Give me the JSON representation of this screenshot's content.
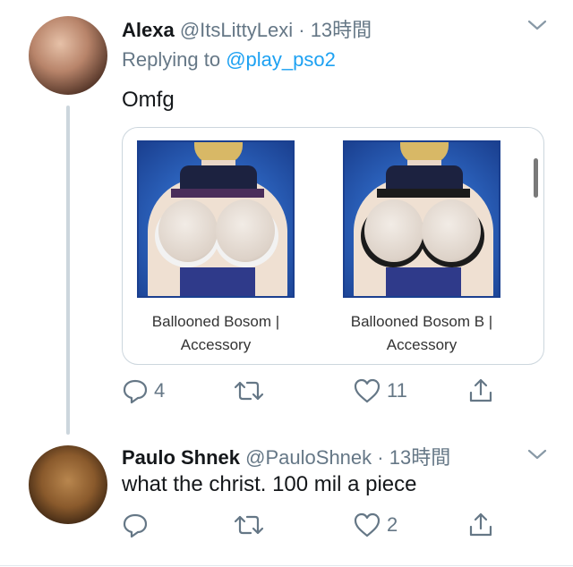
{
  "tweet1": {
    "name": "Alexa",
    "handle": "@ItsLittyLexi",
    "dot": "·",
    "time": "13時間",
    "replying_prefix": "Replying to ",
    "replying_mention": "@play_pso2",
    "text": "Omfg",
    "card": {
      "items": [
        {
          "caption_line1": "Ballooned Bosom |",
          "caption_line2": "Accessory",
          "variant": "white"
        },
        {
          "caption_line1": "Ballooned Bosom B |",
          "caption_line2": "Accessory",
          "variant": "black"
        }
      ]
    },
    "actions": {
      "replies": "4",
      "retweets": "",
      "likes": "11"
    }
  },
  "tweet2": {
    "name": "Paulo Shnek",
    "handle": "@PauloShnek",
    "dot": "·",
    "time": "13時間",
    "text": "what the christ. 100 mil a piece",
    "actions": {
      "replies": "",
      "retweets": "",
      "likes": "2"
    }
  },
  "colors": {
    "accent": "#1da1f2",
    "muted": "#657786",
    "text": "#14171a",
    "line": "#ccd6dd"
  },
  "icons": [
    "chevron-down-icon",
    "reply-icon",
    "retweet-icon",
    "like-icon",
    "share-icon"
  ]
}
